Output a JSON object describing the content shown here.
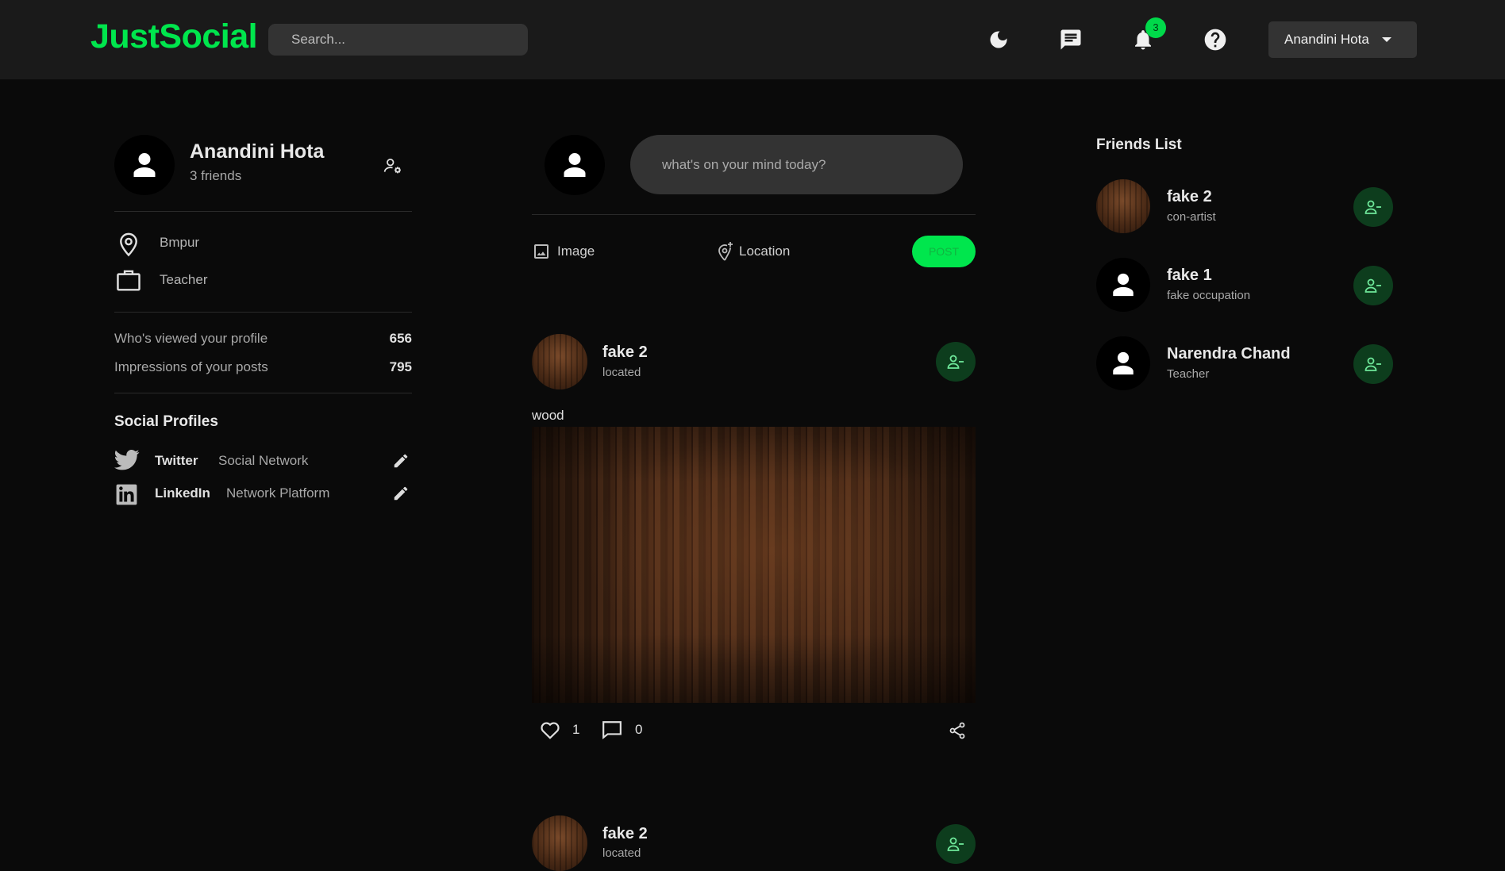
{
  "app": {
    "logo": "JustSocial"
  },
  "header": {
    "search_placeholder": "Search...",
    "notification_count": "3",
    "user_name": "Anandini Hota"
  },
  "profile": {
    "name": "Anandini Hota",
    "friends": "3 friends",
    "location": "Bmpur",
    "occupation": "Teacher",
    "stats": [
      {
        "label": "Who's viewed your profile",
        "value": "656"
      },
      {
        "label": "Impressions of your posts",
        "value": "795"
      }
    ],
    "social_title": "Social Profiles",
    "social": [
      {
        "name": "Twitter",
        "desc": "Social Network"
      },
      {
        "name": "LinkedIn",
        "desc": "Network Platform"
      }
    ]
  },
  "composer": {
    "placeholder": "what's on your mind today?",
    "image_label": "Image",
    "location_label": "Location",
    "post_label": "POST"
  },
  "posts": [
    {
      "author": "fake 2",
      "location": "located",
      "text": "wood",
      "likes": "1",
      "comments": "0"
    },
    {
      "author": "fake 2",
      "location": "located"
    }
  ],
  "friends": {
    "title": "Friends List",
    "items": [
      {
        "name": "fake 2",
        "occupation": "con-artist"
      },
      {
        "name": "fake 1",
        "occupation": "fake occupation"
      },
      {
        "name": "Narendra Chand",
        "occupation": "Teacher"
      }
    ]
  },
  "colors": {
    "accent": "#00e64d",
    "background": "#0a0a0a",
    "navbar": "#1a1a1a"
  }
}
